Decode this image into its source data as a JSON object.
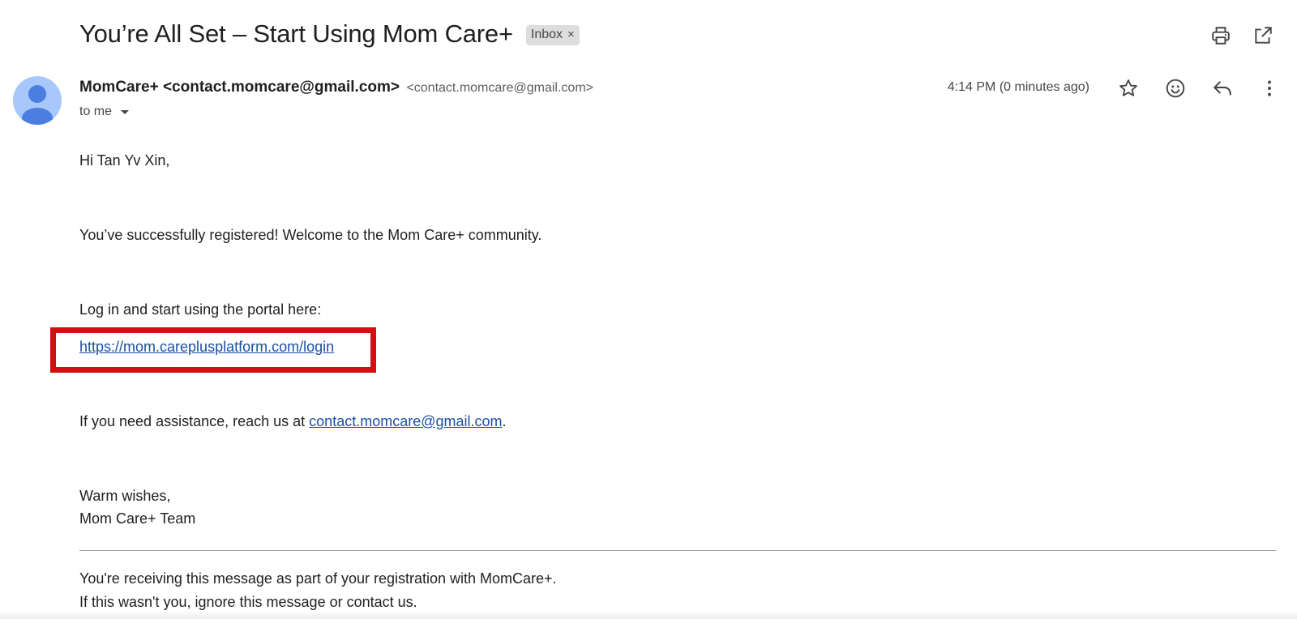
{
  "email": {
    "subject": "You’re All Set – Start Using Mom Care+",
    "label": "Inbox",
    "label_remove": "×",
    "sender_name": "MomCare+ <contact.momcare@gmail.com>",
    "sender_email": "<contact.momcare@gmail.com>",
    "to": "to me",
    "timestamp": "4:14 PM (0 minutes ago)"
  },
  "icons": {
    "print": "printer-icon",
    "open_new_window": "open-in-new-icon",
    "star": "star-icon",
    "emoji": "emoji-icon",
    "reply": "reply-icon",
    "more": "more-vert-icon",
    "avatar": "person-avatar-icon"
  },
  "body": {
    "greeting": "Hi Tan Yv Xin,",
    "welcome": "You’ve successfully registered! Welcome to the Mom Care+ community.",
    "login_prompt": "Log in and start using the portal here:",
    "login_link": "https://mom.careplusplatform.com/login",
    "assist_prefix": "If you need assistance, reach us at ",
    "assist_email": "contact.momcare@gmail.com",
    "assist_suffix": ".",
    "signoff_line1": "Warm wishes,",
    "signoff_line2": "Mom Care+ Team"
  },
  "footer": {
    "line1": "You're receiving this message as part of your registration with MomCare+.",
    "line2": "If this wasn't you, ignore this message or contact us."
  },
  "colors": {
    "link": "#1a4fa5",
    "highlight": "#d40f14",
    "avatar_bg": "#a8c7fa",
    "avatar_fg": "#4a7ee0"
  }
}
